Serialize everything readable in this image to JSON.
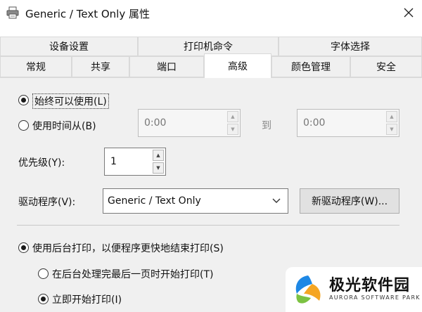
{
  "window": {
    "title": "Generic / Text Only 属性",
    "icon": "printer-icon",
    "close_icon": "close-icon"
  },
  "tabs": {
    "row1": [
      {
        "label": "设备设置"
      },
      {
        "label": "打印机命令"
      },
      {
        "label": "字体选择"
      }
    ],
    "row2": [
      {
        "label": "常规"
      },
      {
        "label": "共享"
      },
      {
        "label": "端口"
      },
      {
        "label": "高级",
        "active": true
      },
      {
        "label": "颜色管理"
      },
      {
        "label": "安全"
      }
    ]
  },
  "advanced": {
    "availability": {
      "always_label": "始终可以使用(L)",
      "always_selected": true,
      "from_label": "使用时间从(B)",
      "from_selected": false,
      "from_value": "0:00",
      "to_label": "到",
      "to_value": "0:00"
    },
    "priority": {
      "label": "优先级(Y):",
      "value": "1"
    },
    "driver": {
      "label": "驱动程序(V):",
      "value": "Generic / Text Only",
      "new_driver_button": "新驱动程序(W)..."
    },
    "spool": {
      "spool_label": "使用后台打印，以便程序更快地结束打印(S)",
      "spool_selected": true,
      "after_last_page_label": "在后台处理完最后一页时开始打印(T)",
      "after_last_page_selected": false,
      "immediately_label": "立即开始打印(I)",
      "immediately_selected": true
    }
  },
  "logo": {
    "title": "极光软件园",
    "subtitle": "AURORA SOFTWARE PARK"
  },
  "colors": {
    "panel_bg": "#f0f0f0",
    "logo_blue": "#1e88e5",
    "logo_orange": "#f5a623",
    "logo_green": "#7cc242"
  }
}
